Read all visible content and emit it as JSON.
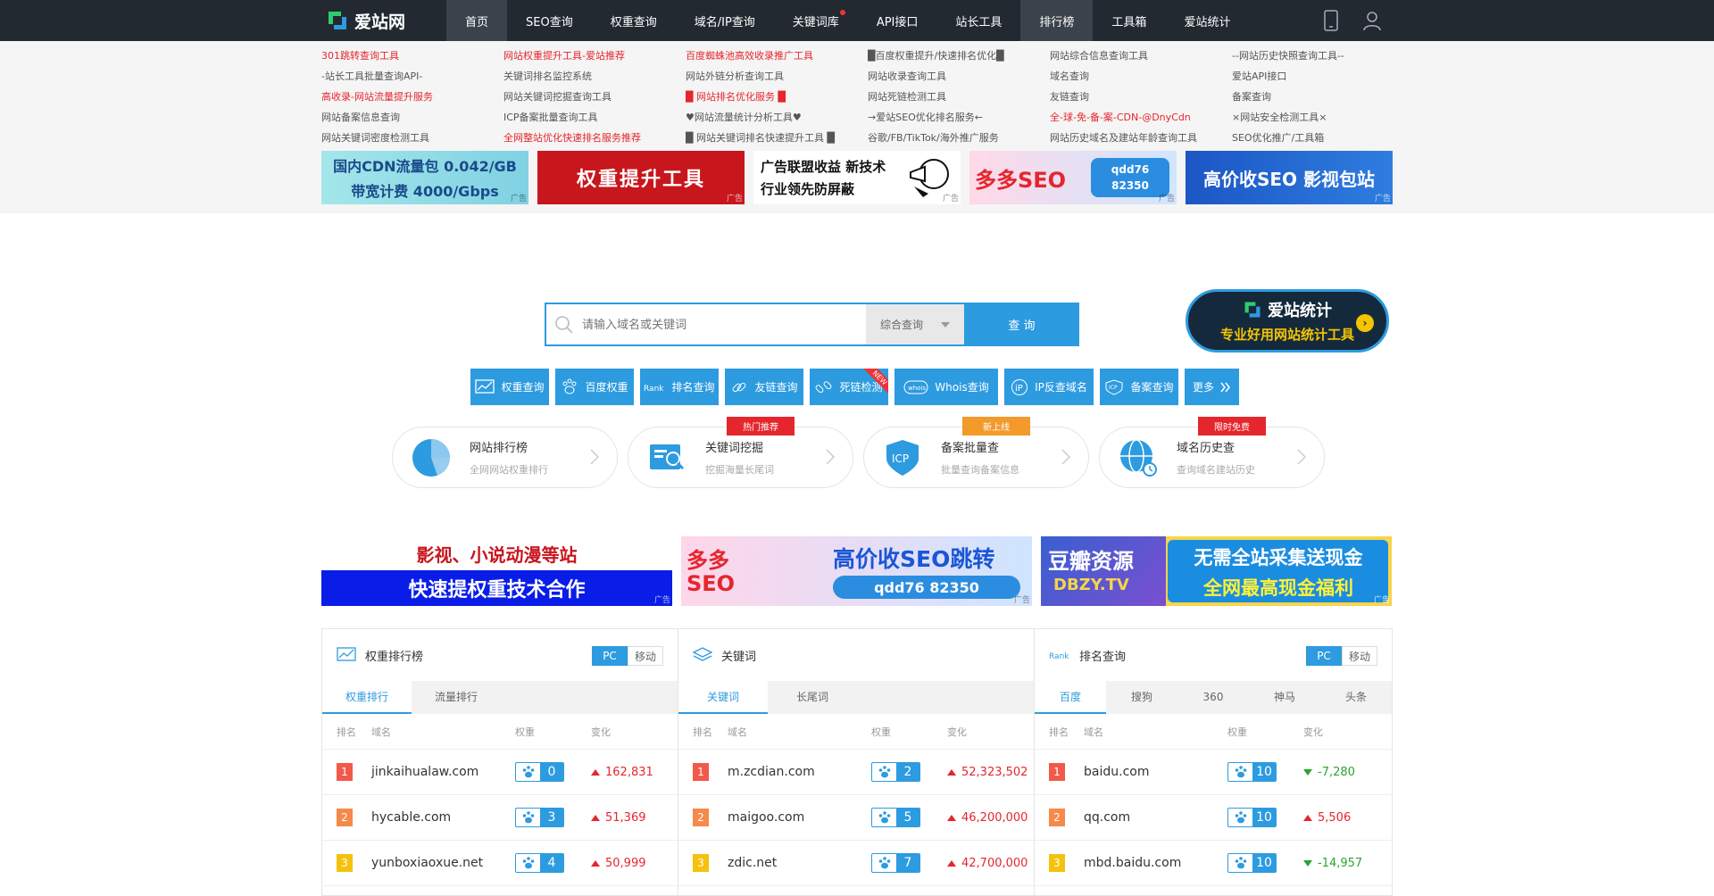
{
  "header": {
    "logo_text": "爱站网",
    "nav": [
      {
        "label": "首页",
        "active": true
      },
      {
        "label": "SEO查询"
      },
      {
        "label": "权重查询"
      },
      {
        "label": "域名/IP查询"
      },
      {
        "label": "关键词库",
        "dot": true
      },
      {
        "label": "API接口"
      },
      {
        "label": "站长工具"
      },
      {
        "label": "排行榜"
      },
      {
        "label": "工具箱"
      },
      {
        "label": "爱站统计"
      }
    ]
  },
  "links": [
    {
      "text": "301跳转查询工具",
      "red": true
    },
    {
      "text": "网站权重提升工具-爱站推荐",
      "red": true
    },
    {
      "text": "百度蜘蛛池高效收录推广工具",
      "red": true
    },
    {
      "text": "█百度权重提升/快速排名优化█",
      "red": false
    },
    {
      "text": "网站综合信息查询工具",
      "red": false
    },
    {
      "text": "--网站历史快照查询工具--",
      "red": false
    },
    {
      "text": "-站长工具批量查询API-",
      "red": false
    },
    {
      "text": "关键词排名监控系统",
      "red": false
    },
    {
      "text": "网站外链分析查询工具",
      "red": false
    },
    {
      "text": "网站收录查询工具",
      "red": false
    },
    {
      "text": "域名查询",
      "red": false
    },
    {
      "text": "爱站API接口",
      "red": false
    },
    {
      "text": "高收录-网站流量提升服务",
      "red": true
    },
    {
      "text": "网站关键词挖掘查询工具",
      "red": false
    },
    {
      "text": "█ 网站排名优化服务 █",
      "red": true
    },
    {
      "text": "网站死链检测工具",
      "red": false
    },
    {
      "text": "友链查询",
      "red": false
    },
    {
      "text": "备案查询",
      "red": false
    },
    {
      "text": "网站备案信息查询",
      "red": false
    },
    {
      "text": "ICP备案批量查询工具",
      "red": false
    },
    {
      "text": "♥网站流量统计分析工具♥",
      "red": false
    },
    {
      "text": "→爱站SEO优化排名服务←",
      "red": false
    },
    {
      "text": "全-球-免-备-案-CDN-@DnyCdn",
      "red": true
    },
    {
      "text": "×网站安全检测工具×",
      "red": false
    },
    {
      "text": "网站关键词密度检测工具",
      "red": false
    },
    {
      "text": "全网整站优化快速排名服务推荐",
      "red": true
    },
    {
      "text": "█ 网站关键词排名快速提升工具 █",
      "red": false
    },
    {
      "text": "谷歌/FB/TikTok/海外推广服务",
      "red": false
    },
    {
      "text": "网站历史域名及建站年龄查询工具",
      "red": false
    },
    {
      "text": "SEO优化推广/工具箱",
      "red": false
    }
  ],
  "banners_top": [
    {
      "line1": "国内CDN流量包 0.042/GB",
      "line2": "带宽计费 4000/Gbps",
      "ad": "广告"
    },
    {
      "line1": "权重提升工具",
      "ad": "广告"
    },
    {
      "line1": "广告联盟收益 新技术",
      "line2": "行业领先防屏蔽",
      "ad": "广告"
    },
    {
      "line1": "多多SEO",
      "line2": "qdd76  82350",
      "ad": "广告"
    },
    {
      "line1": "高价收SEO 影视包站",
      "ad": "广告"
    }
  ],
  "search": {
    "placeholder": "请输入域名或关键词",
    "select_label": "综合查询",
    "button_label": "查 询"
  },
  "promo": {
    "title": "爱站统计",
    "subtitle": "专业好用网站统计工具"
  },
  "tools": [
    {
      "label": "权重查询",
      "icon": "chart-icon"
    },
    {
      "label": "百度权重",
      "icon": "paw-icon"
    },
    {
      "label": "排名查询",
      "icon": "rank-icon"
    },
    {
      "label": "友链查询",
      "icon": "link-icon"
    },
    {
      "label": "死链检测",
      "icon": "broken-link-icon",
      "new": "NEW"
    },
    {
      "label": "Whois查询",
      "icon": "whois-icon"
    },
    {
      "label": "IP反查域名",
      "icon": "ip-icon"
    },
    {
      "label": "备案查询",
      "icon": "icp-icon"
    },
    {
      "label": "更多",
      "icon": "more-icon"
    }
  ],
  "cards": [
    {
      "title": "网站排行榜",
      "subtitle": "全网网站权重排行",
      "tag": ""
    },
    {
      "title": "关键词挖掘",
      "subtitle": "挖掘海量长尾词",
      "tag": "热门推荐",
      "tag_color": "#e5262d"
    },
    {
      "title": "备案批量查",
      "subtitle": "批量查询备案信息",
      "tag": "新上线",
      "tag_color": "#f39a2b"
    },
    {
      "title": "域名历史查",
      "subtitle": "查询域名建站历史",
      "tag": "限时免费",
      "tag_color": "#e5262d"
    }
  ],
  "banners_mid": [
    {
      "line1": "影视、小说动漫等站",
      "line2": "快速提权重技术合作",
      "ad": "广告"
    },
    {
      "line1": "高价收SEO跳转",
      "line2": "qdd76  82350",
      "brand": "多多SEO",
      "ad": "广告"
    },
    {
      "line1": "豆瓣资源",
      "line2": "DBZY.TV",
      "line3": "无需全站采集送现金",
      "line4": "全网最高现金福利",
      "ad": "广告"
    }
  ],
  "panels": [
    {
      "title": "权重排行榜",
      "toggle": [
        "PC",
        "移动"
      ],
      "tabs": [
        "权重排行",
        "流量排行"
      ],
      "cols": [
        "排名",
        "域名",
        "权重",
        "变化"
      ],
      "rows": [
        {
          "rank": "1",
          "domain": "jinkaihualaw.com",
          "weight": "0",
          "change": "162,831",
          "dir": "up"
        },
        {
          "rank": "2",
          "domain": "hycable.com",
          "weight": "3",
          "change": "51,369",
          "dir": "up"
        },
        {
          "rank": "3",
          "domain": "yunboxiaoxue.net",
          "weight": "4",
          "change": "50,999",
          "dir": "up"
        }
      ]
    },
    {
      "title": "关键词",
      "toggle": [],
      "tabs": [
        "关键词",
        "长尾词"
      ],
      "cols": [
        "排名",
        "域名",
        "权重",
        "变化"
      ],
      "rows": [
        {
          "rank": "1",
          "domain": "m.zcdian.com",
          "weight": "2",
          "change": "52,323,502",
          "dir": "up"
        },
        {
          "rank": "2",
          "domain": "maigoo.com",
          "weight": "5",
          "change": "46,200,000",
          "dir": "up"
        },
        {
          "rank": "3",
          "domain": "zdic.net",
          "weight": "7",
          "change": "42,700,000",
          "dir": "up"
        }
      ]
    },
    {
      "title": "排名查询",
      "toggle": [
        "PC",
        "移动"
      ],
      "tabs": [
        "百度",
        "搜狗",
        "360",
        "神马",
        "头条"
      ],
      "cols": [
        "排名",
        "域名",
        "权重",
        "变化"
      ],
      "rows": [
        {
          "rank": "1",
          "domain": "baidu.com",
          "weight": "10",
          "change": "-7,280",
          "dir": "down"
        },
        {
          "rank": "2",
          "domain": "qq.com",
          "weight": "10",
          "change": "5,506",
          "dir": "up"
        },
        {
          "rank": "3",
          "domain": "mbd.baidu.com",
          "weight": "10",
          "change": "-14,957",
          "dir": "down"
        }
      ]
    }
  ],
  "colors": {
    "accent": "#2d9be0",
    "topbar": "#222930",
    "red": "#e5262d",
    "green": "#2aa52d",
    "rank1": "#f15a4a",
    "rank2": "#f58a4b",
    "rank3": "#f4c20d"
  }
}
